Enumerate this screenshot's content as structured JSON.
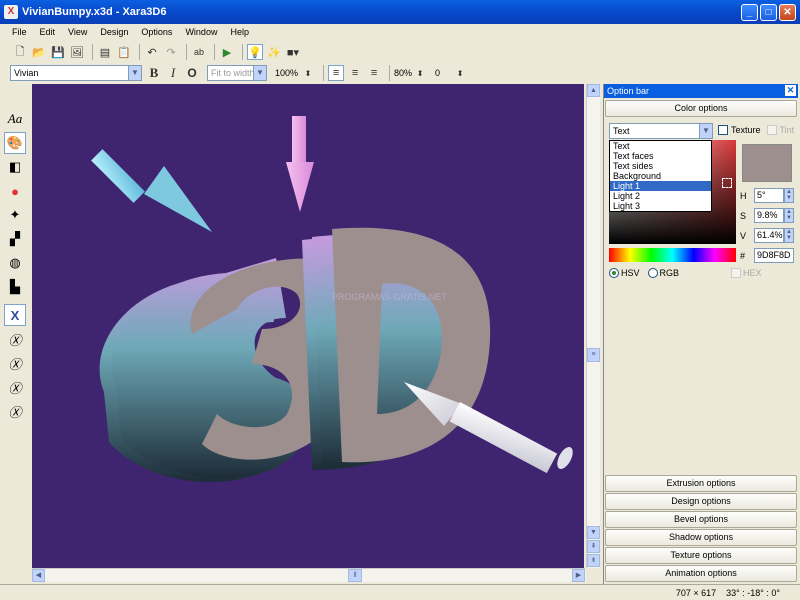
{
  "window": {
    "title": "VivianBumpy.x3d - Xara3D6"
  },
  "menu": [
    "File",
    "Edit",
    "View",
    "Design",
    "Options",
    "Window",
    "Help"
  ],
  "toolbar2": {
    "font": "Vivian",
    "fit": "Fit to width",
    "zoom": "100%",
    "line_spacing": "80%",
    "char_spacing": "0"
  },
  "viewport": {
    "text": "3D",
    "watermark": "PROGRAMAS-GRATIS.NET"
  },
  "panel": {
    "title": "Option bar",
    "color_options": "Color options",
    "target_select": "Text",
    "texture_label": "Texture",
    "tint_label": "Tint",
    "dropdown_items": [
      "Text",
      "Text faces",
      "Text sides",
      "Background",
      "Light 1",
      "Light 2",
      "Light 3"
    ],
    "dropdown_selected": 4,
    "h_label": "H",
    "h_value": "5°",
    "s_label": "S",
    "s_value": "9.8%",
    "v_label": "V",
    "v_value": "61.4%",
    "hash_label": "#",
    "hex_value": "9D8F8D",
    "hsv_label": "HSV",
    "rgb_label": "RGB",
    "hex_label": "HEX",
    "swatch_color": "#9D8F8D",
    "sections": [
      "Extrusion options",
      "Design options",
      "Bevel options",
      "Shadow options",
      "Texture options",
      "Animation options"
    ]
  },
  "status": {
    "size": "707 × 617",
    "angles": "33° : -18° : 0°"
  }
}
